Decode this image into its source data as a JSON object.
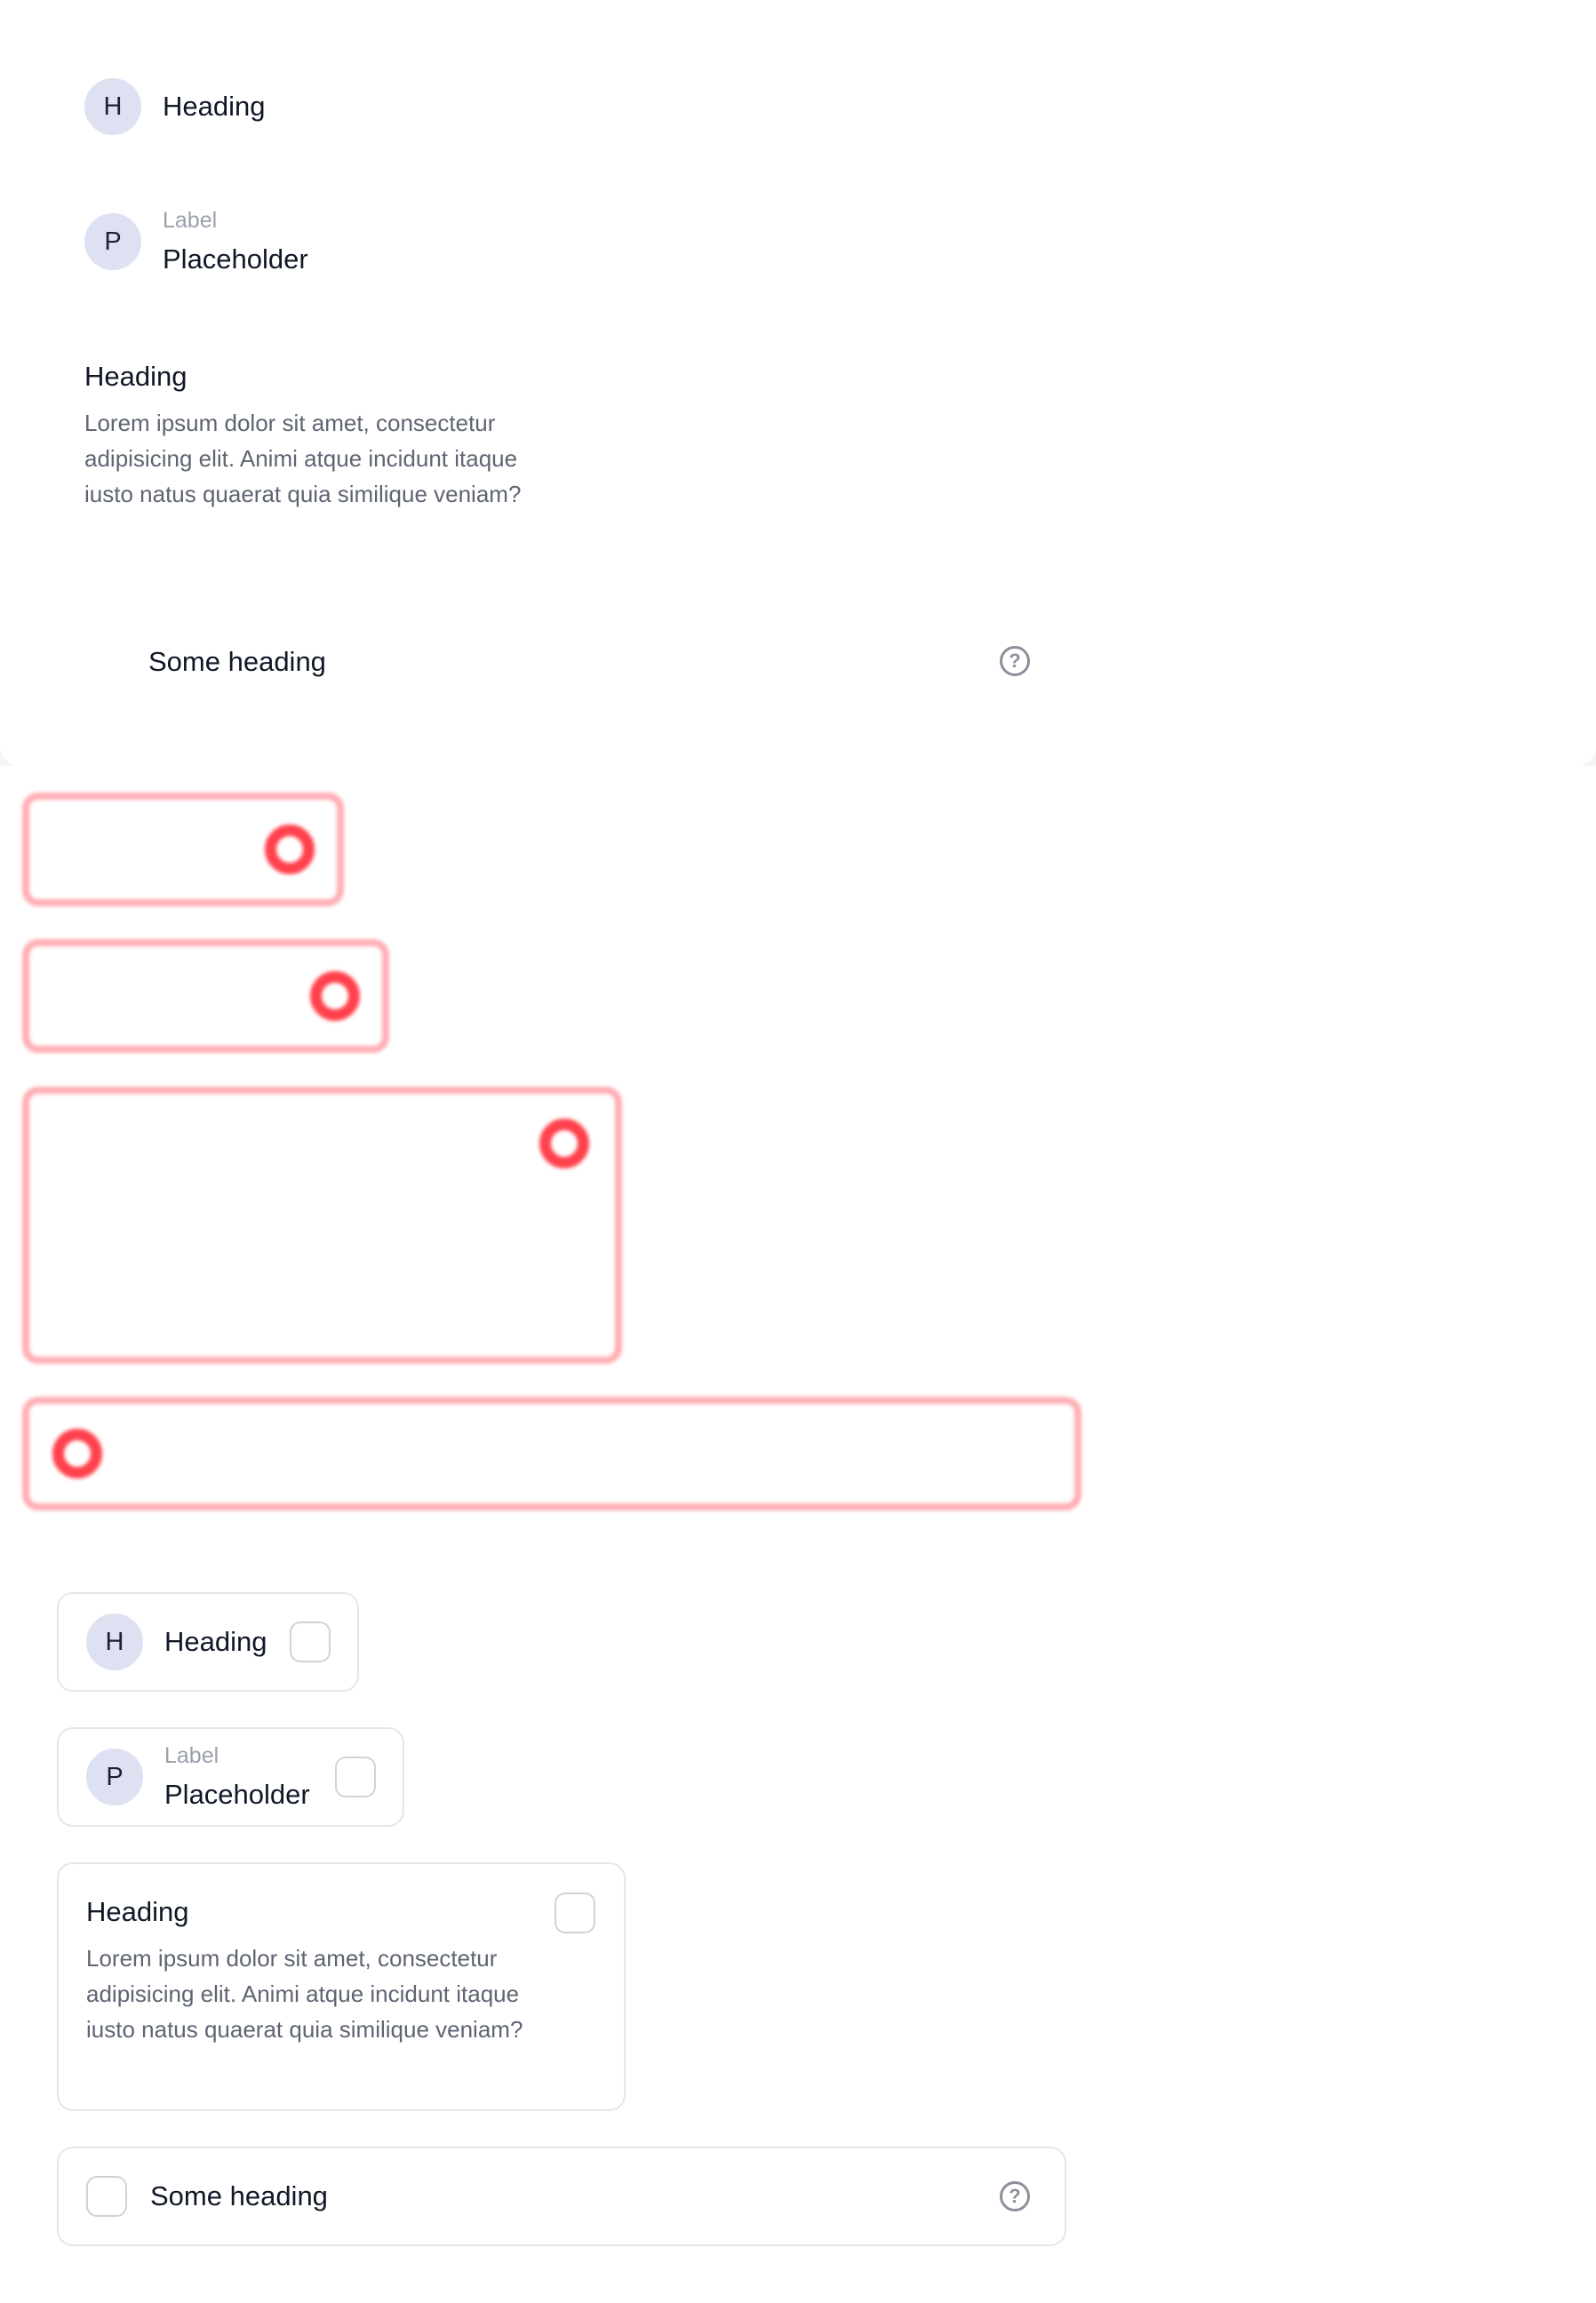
{
  "top": {
    "item1": {
      "avatar_letter": "H",
      "title": "Heading"
    },
    "item2": {
      "avatar_letter": "P",
      "label": "Label",
      "value": "Placeholder"
    },
    "item3": {
      "title": "Heading",
      "body": "Lorem ipsum dolor sit amet, consectetur adipisicing elit. Animi atque incidunt itaque iusto natus quaerat quia similique veniam?"
    },
    "item4": {
      "title": "Some heading",
      "help_icon": "question-circle-icon"
    }
  },
  "cards": {
    "card1": {
      "avatar_letter": "H",
      "title": "Heading"
    },
    "card2": {
      "avatar_letter": "P",
      "label": "Label",
      "value": "Placeholder"
    },
    "card3": {
      "title": "Heading",
      "body": "Lorem ipsum dolor sit amet, consectetur adipisicing elit. Animi atque incidunt itaque iusto natus quaerat quia similique veniam?"
    },
    "card4": {
      "title": "Some heading",
      "help_icon": "question-circle-icon"
    }
  },
  "colors": {
    "avatar_bg": "#dde1f2",
    "ghost_outline": "#ff6b74",
    "ghost_handle": "#ff2d3a",
    "card_border": "#e3e6eb"
  }
}
